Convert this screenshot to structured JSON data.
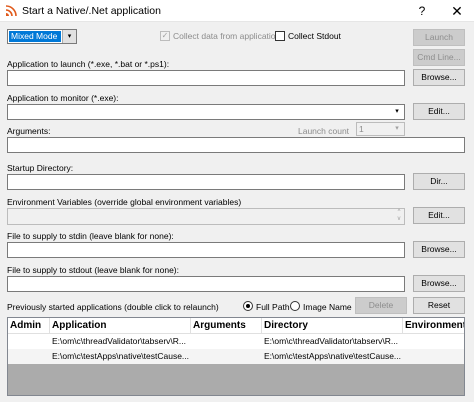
{
  "window": {
    "title": "Start a Native/.Net application",
    "help": "?",
    "close": "✕"
  },
  "mode": {
    "value": "Mixed Mode"
  },
  "collect_data": {
    "label": "Collect data from application",
    "checked": true,
    "mark": "✓"
  },
  "collect_stdout": {
    "label": "Collect Stdout",
    "checked": false
  },
  "buttons": {
    "launch": "Launch",
    "cmd_line": "Cmd Line...",
    "browse_app": "Browse...",
    "edit_monitor": "Edit...",
    "dir": "Dir...",
    "edit_env": "Edit...",
    "browse_stdin": "Browse...",
    "browse_stdout": "Browse...",
    "delete": "Delete",
    "reset": "Reset"
  },
  "fields": {
    "app_label": "Application to launch (*.exe, *.bat or *.ps1):",
    "monitor_label": "Application to monitor (*.exe):",
    "args_label": "Arguments:",
    "launch_count_label": "Launch count",
    "launch_count_value": "1",
    "startup_label": "Startup Directory:",
    "env_label": "Environment Variables (override global environment variables)",
    "stdin_label": "File to supply to stdin (leave blank for none):",
    "stdout_label": "File to supply to stdout (leave blank for none):"
  },
  "history": {
    "label": "Previously started applications (double click to relaunch)",
    "full_path": "Full Path",
    "image_name": "Image Name",
    "selected_view": "Full Path"
  },
  "table": {
    "columns": [
      "Admin",
      "Application",
      "Arguments",
      "Directory",
      "Environment"
    ],
    "rows": [
      {
        "admin": "",
        "application": "E:\\om\\c\\threadValidator\\tabserv\\R...",
        "arguments": "",
        "directory": "E:\\om\\c\\threadValidator\\tabserv\\R...",
        "environment": ""
      },
      {
        "admin": "",
        "application": "E:\\om\\c\\testApps\\native\\testCause...",
        "arguments": "",
        "directory": "E:\\om\\c\\testApps\\native\\testCause...",
        "environment": ""
      }
    ]
  },
  "glyphs": {
    "combo_arrow": "▾",
    "spin_up": "^",
    "spin_down": "v"
  },
  "colors": {
    "accent": "#0078d7",
    "dialog_bg": "#f0f0f0",
    "table_bg": "#ababab"
  }
}
